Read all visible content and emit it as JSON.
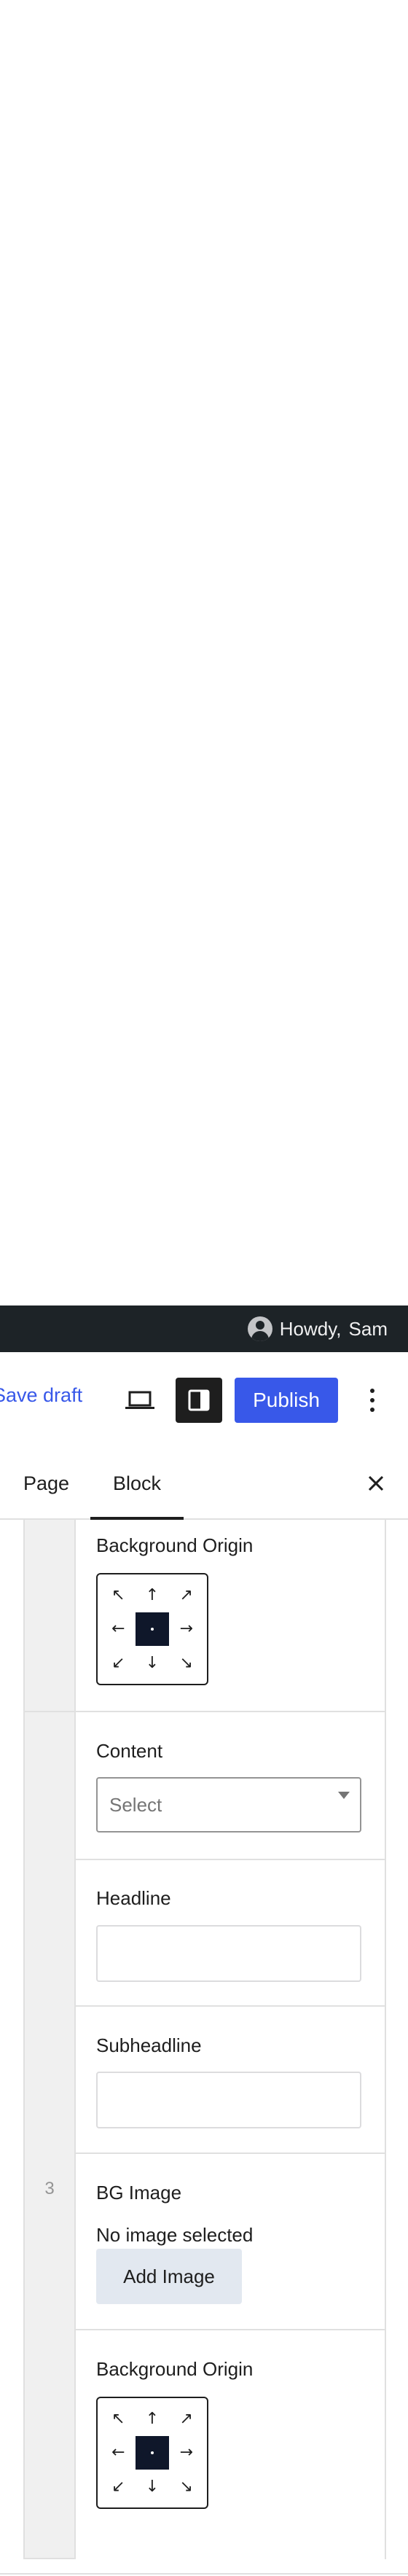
{
  "admin_bar": {
    "greeting": "Howdy,",
    "username": "Sam",
    "avatar_icon": "user-avatar-icon"
  },
  "toolbar": {
    "save_draft": "Save draft",
    "publish": "Publish",
    "preview_icon": "laptop-icon",
    "sidebar_icon": "sidebar-toggle-icon",
    "more_icon": "kebab-menu-icon",
    "publish_color": "#3858e9"
  },
  "tabs": {
    "page": "Page",
    "block": "Block",
    "active": "Block"
  },
  "panel": {
    "row_number": "3",
    "top_section": {
      "origin_label": "Background Origin",
      "selected_origin": "center"
    },
    "row3": {
      "content_label": "Content",
      "content_select": "Select",
      "headline_label": "Headline",
      "headline_value": "",
      "subheadline_label": "Subheadline",
      "subheadline_value": "",
      "bg_image_label": "BG Image",
      "no_image_text": "No image selected",
      "add_image_button": "Add Image",
      "origin_label": "Background Origin",
      "selected_origin": "center"
    },
    "origin_arrows": [
      "↖",
      "↑",
      "↗",
      "←",
      "",
      "→",
      "↙",
      "↓",
      "↘"
    ]
  }
}
